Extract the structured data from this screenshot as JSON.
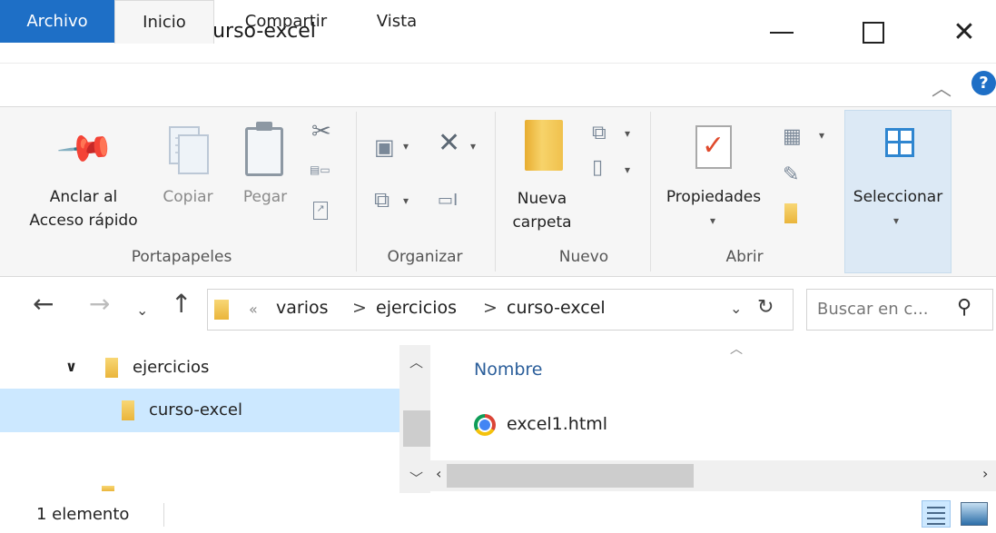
{
  "window": {
    "title": "curso-excel",
    "quick_access_dropdown": "="
  },
  "tabs": [
    {
      "label": "Archivo",
      "active": false,
      "accent": "#1e6fc6"
    },
    {
      "label": "Inicio",
      "active": true
    },
    {
      "label": "Compartir",
      "active": false
    },
    {
      "label": "Vista",
      "active": false
    }
  ],
  "help_label": "?",
  "ribbon": {
    "portapapeles": {
      "group_label": "Portapapeles",
      "pin_line1": "Anclar al",
      "pin_line2": "Acceso rápido",
      "copy": "Copiar",
      "paste": "Pegar"
    },
    "organizar": {
      "group_label": "Organizar"
    },
    "nuevo": {
      "group_label": "Nuevo",
      "new_folder_line1": "Nueva",
      "new_folder_line2": "carpeta"
    },
    "abrir": {
      "group_label": "Abrir",
      "properties": "Propiedades"
    },
    "seleccionar": {
      "label": "Seleccionar"
    }
  },
  "address": {
    "overflow": "«",
    "crumbs": [
      "varios",
      "ejercicios",
      "curso-excel"
    ],
    "separator": ">",
    "search_placeholder": "Buscar en c..."
  },
  "nav_pane": {
    "items": [
      {
        "label": "ejercicios",
        "expanded": true,
        "selected": false
      },
      {
        "label": "curso-excel",
        "selected": true
      }
    ]
  },
  "content": {
    "column_header": "Nombre",
    "files": [
      {
        "name": "excel1.html",
        "icon": "chrome-icon"
      }
    ]
  },
  "status": {
    "item_count": "1 elemento"
  }
}
